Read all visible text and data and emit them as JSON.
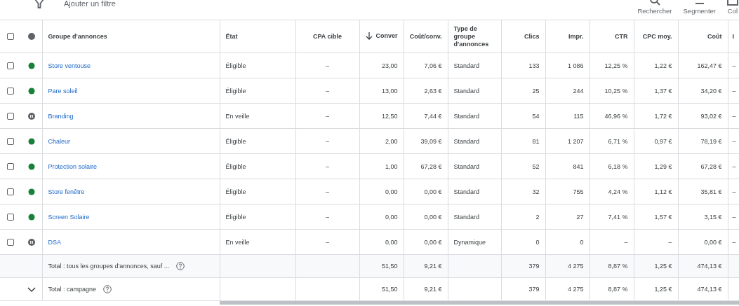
{
  "toolbar": {
    "filter_placeholder": "Ajouter un filtre",
    "actions": [
      {
        "kind": "search",
        "label": "Rechercher"
      },
      {
        "kind": "segment",
        "label": "Segmenter"
      },
      {
        "kind": "columns",
        "label": "Col"
      }
    ]
  },
  "table": {
    "header_checkbox": {
      "checked": false
    },
    "columns": [
      {
        "label": "Groupe d'annonces",
        "kind": "text",
        "sorted": false
      },
      {
        "label": "État",
        "kind": "text",
        "sorted": false
      },
      {
        "label": "CPA cible",
        "kind": "center",
        "sorted": false
      },
      {
        "label": "Conver",
        "kind": "number",
        "sorted": true
      },
      {
        "label": "Coût/conv.",
        "kind": "number",
        "sorted": false
      },
      {
        "label": "Type de groupe d'annonces",
        "kind": "text",
        "sorted": false
      },
      {
        "label": "Clics",
        "kind": "number",
        "sorted": false
      },
      {
        "label": "Impr.",
        "kind": "number",
        "sorted": false
      },
      {
        "label": "CTR",
        "kind": "number",
        "sorted": false
      },
      {
        "label": "CPC moy.",
        "kind": "number",
        "sorted": false
      },
      {
        "label": "Coût",
        "kind": "number",
        "sorted": false
      },
      {
        "label": "I",
        "kind": "text",
        "sorted": false
      }
    ],
    "rows": [
      {
        "checked": false,
        "enabled": true,
        "cells": [
          "Store ventouse",
          "Éligible",
          "–",
          "23,00",
          "7,06 €",
          "Standard",
          "133",
          "1 086",
          "12,25 %",
          "1,22 €",
          "162,47 €",
          "–"
        ]
      },
      {
        "checked": false,
        "enabled": true,
        "cells": [
          "Pare soleil",
          "Éligible",
          "–",
          "13,00",
          "2,63 €",
          "Standard",
          "25",
          "244",
          "10,25 %",
          "1,37 €",
          "34,20 €",
          "–"
        ]
      },
      {
        "checked": false,
        "enabled": false,
        "cells": [
          "Branding",
          "En veille",
          "–",
          "12,50",
          "7,44 €",
          "Standard",
          "54",
          "115",
          "46,96 %",
          "1,72 €",
          "93,02 €",
          "–"
        ]
      },
      {
        "checked": false,
        "enabled": true,
        "cells": [
          "Chaleur",
          "Éligible",
          "–",
          "2,00",
          "39,09 €",
          "Standard",
          "81",
          "1 207",
          "6,71 %",
          "0,97 €",
          "78,19 €",
          "–"
        ]
      },
      {
        "checked": false,
        "enabled": true,
        "cells": [
          "Protection solaire",
          "Éligible",
          "–",
          "1,00",
          "67,28 €",
          "Standard",
          "52",
          "841",
          "6,18 %",
          "1,29 €",
          "67,28 €",
          "–"
        ]
      },
      {
        "checked": false,
        "enabled": true,
        "cells": [
          "Store fenêtre",
          "Éligible",
          "–",
          "0,00",
          "0,00 €",
          "Standard",
          "32",
          "755",
          "4,24 %",
          "1,12 €",
          "35,81 €",
          "–"
        ]
      },
      {
        "checked": false,
        "enabled": true,
        "cells": [
          "Screen Solaire",
          "Éligible",
          "–",
          "0,00",
          "0,00 €",
          "Standard",
          "2",
          "27",
          "7,41 %",
          "1,57 €",
          "3,15 €",
          "–"
        ]
      },
      {
        "checked": false,
        "enabled": false,
        "cells": [
          "DSA",
          "En veille",
          "–",
          "0,00",
          "0,00 €",
          "Dynamique",
          "0",
          "0",
          "–",
          "–",
          "0,00 €",
          "–"
        ]
      }
    ],
    "totals": [
      {
        "kind": "filtered",
        "cells": [
          "Total : tous les groupes d'annonces, sauf ...",
          "",
          "",
          "51,50",
          "9,21 €",
          "",
          "379",
          "4 275",
          "8,87 %",
          "1,25 €",
          "474,13 €",
          ""
        ]
      },
      {
        "kind": "campaign",
        "cells": [
          "Total : campagne",
          "",
          "",
          "51,50",
          "9,21 €",
          "",
          "379",
          "4 275",
          "8,87 %",
          "1,25 €",
          "474,13 €",
          ""
        ]
      }
    ]
  }
}
